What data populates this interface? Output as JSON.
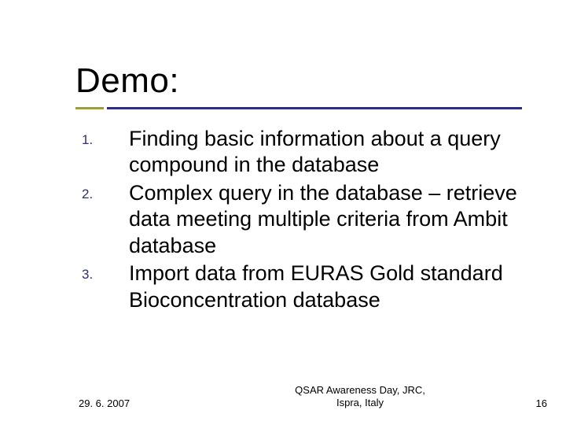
{
  "title": "Demo:",
  "items": [
    {
      "marker": "1.",
      "text": "Finding basic information about a query compound in the database"
    },
    {
      "marker": "2.",
      "text": "Complex query in the database – retrieve data meeting multiple criteria from Ambit database"
    },
    {
      "marker": "3.",
      "text": "Import data from EURAS Gold standard Bioconcentration database"
    }
  ],
  "footer": {
    "date": "29. 6. 2007",
    "venue_line1": "QSAR Awareness Day, JRC,",
    "venue_line2": "Ispra, Italy",
    "page": "16"
  }
}
